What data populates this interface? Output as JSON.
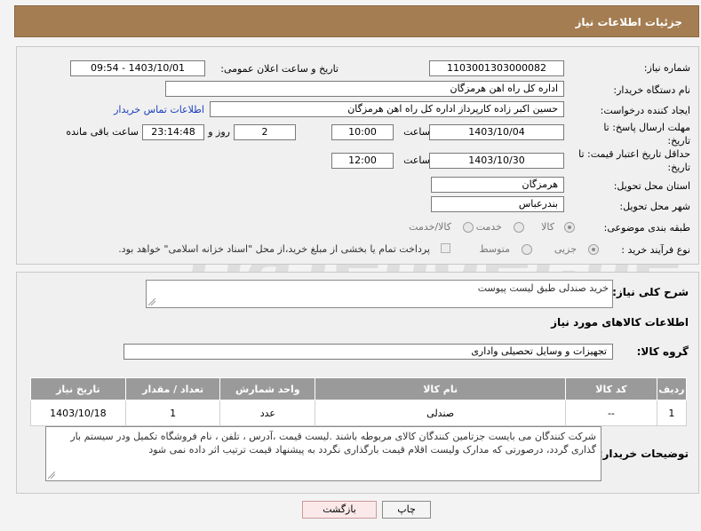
{
  "header": {
    "title": "جزئیات اطلاعات نیاز"
  },
  "watermark": {
    "text": "AriaTender.neT"
  },
  "form": {
    "need_number_label": "شماره نیاز:",
    "need_number": "1103001303000082",
    "announce_label": "تاریخ و ساعت اعلان عمومی:",
    "announce_value": "1403/10/01 - 09:54",
    "buyer_org_label": "نام دستگاه خریدار:",
    "buyer_org": "اداره کل راه اهن هرمزگان",
    "requester_label": "ایجاد کننده درخواست:",
    "requester": "حسین اکبر زاده  کارپرداز اداره کل راه اهن هرمزگان",
    "contact_link": "اطلاعات تماس خریدار",
    "deadline_label_1": "مهلت ارسال پاسخ: تا",
    "deadline_label_2": "تاریخ:",
    "deadline_date": "1403/10/04",
    "time_label": "ساعت",
    "deadline_time": "10:00",
    "days_value": "2",
    "days_label": "روز و",
    "remaining_time": "23:14:48",
    "remaining_label": "ساعت باقی مانده",
    "validity_label_1": "حداقل تاریخ اعتبار قیمت: تا",
    "validity_label_2": "تاریخ:",
    "validity_date": "1403/10/30",
    "validity_time": "12:00",
    "province_label": "استان محل تحویل:",
    "province": "هرمزگان",
    "city_label": "شهر محل تحویل:",
    "city": "بندرعباس",
    "category_label": "طبقه بندی موضوعی:",
    "category_options": [
      "کالا",
      "خدمت",
      "کالا/خدمت"
    ],
    "process_label": "نوع فرآیند خرید :",
    "process_options": [
      "جزیی",
      "متوسط"
    ],
    "payment_note": "پرداخت تمام یا بخشی از مبلغ خرید،از محل \"اسناد خزانه اسلامی\" خواهد بود."
  },
  "details": {
    "summary_label": "شرح کلی نیاز:",
    "summary_value": "خرید صندلی طبق لیست پیوست",
    "goods_info_title": "اطلاعات کالاهای مورد نیاز",
    "group_label": "گروه کالا:",
    "group_value": "تجهیزات و وسایل تحصیلی واداری",
    "table": {
      "headers": [
        "ردیف",
        "کد کالا",
        "نام کالا",
        "واحد شمارش",
        "تعداد / مقدار",
        "تاریخ نیاز"
      ],
      "rows": [
        [
          "1",
          "--",
          "صندلی",
          "عدد",
          "1",
          "1403/10/18"
        ]
      ]
    },
    "buyer_notes_label": "توضیحات خریدار:",
    "buyer_notes": "شرکت کنندگان می بایست جزتامین کنندگان کالای مربوطه باشند .لیست قیمت  ،آدرس ، تلفن ، نام فروشگاه تکمیل ودر سیستم بار گذاری گردد، درصورتی که مدارک ولیست اقلام قیمت بارگذاری نگردد به پیشنهاد قیمت ترتیب اثر داده نمی شود"
  },
  "buttons": {
    "print": "چاپ",
    "back": "بازگشت"
  }
}
